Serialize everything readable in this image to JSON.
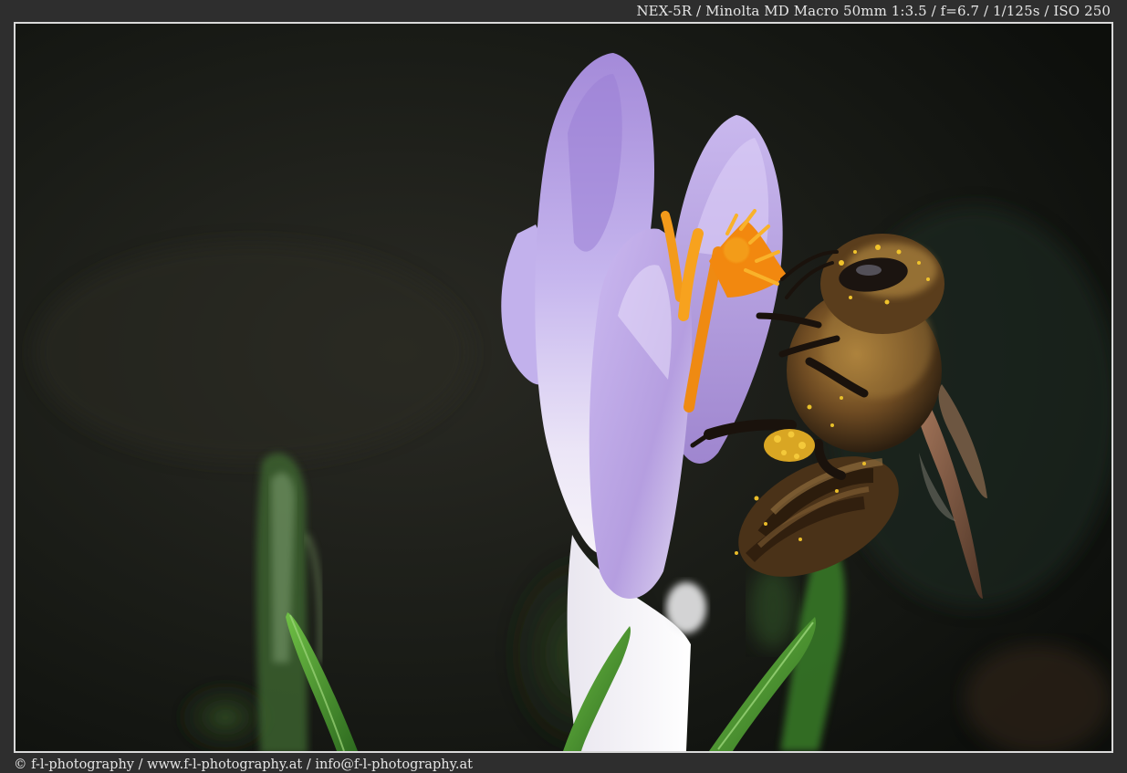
{
  "header": {
    "exif": "NEX-5R / Minolta MD Macro 50mm 1:3.5 / f=6.7 / 1/125s / ISO 250"
  },
  "photo": {
    "subject_icon": "bee-on-crocus-photo",
    "colors": {
      "background": "#121411",
      "petal": "#b7a4e2",
      "stamen": "#f08a12",
      "bee": "#7a5226",
      "leaf": "#4f9a35"
    }
  },
  "footer": {
    "credits": "© f-l-photography / www.f-l-photography.at / info@f-l-photography.at"
  }
}
